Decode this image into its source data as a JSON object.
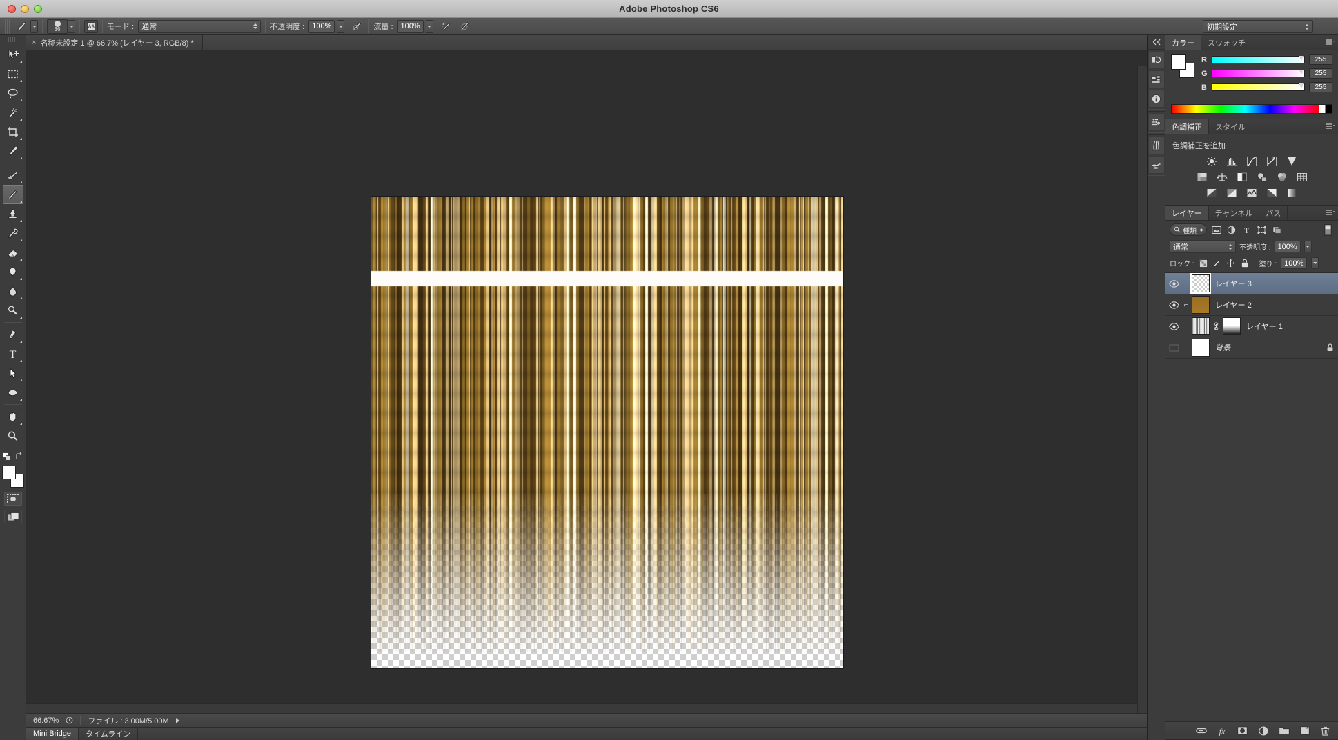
{
  "window": {
    "title": "Adobe Photoshop CS6",
    "traffic_lights": [
      "close",
      "minimize",
      "maximize"
    ]
  },
  "options_bar": {
    "tool_icon": "brush-tool-icon",
    "brush_size": "36",
    "tablet_pressure_icon": "brush-panel-icon",
    "mode_label": "モード :",
    "mode_value": "通常",
    "opacity_label": "不透明度 :",
    "opacity_value": "100%",
    "opacity_pressure_icon": "pressure-opacity-icon",
    "flow_label": "流量 :",
    "flow_value": "100%",
    "airbrush_icon": "airbrush-icon",
    "flow_pressure_icon": "pressure-size-icon",
    "workspace_value": "初期設定"
  },
  "toolbar": {
    "tools": [
      {
        "name": "move-tool",
        "active": false
      },
      {
        "name": "marquee-tool",
        "active": false
      },
      {
        "name": "lasso-tool",
        "active": false
      },
      {
        "name": "magic-wand-tool",
        "active": false
      },
      {
        "name": "crop-tool",
        "active": false
      },
      {
        "name": "eyedropper-tool",
        "active": false
      },
      {
        "name": "healing-brush-tool",
        "active": false
      },
      {
        "name": "brush-tool",
        "active": true
      },
      {
        "name": "clone-stamp-tool",
        "active": false
      },
      {
        "name": "history-brush-tool",
        "active": false
      },
      {
        "name": "eraser-tool",
        "active": false
      },
      {
        "name": "gradient-tool",
        "active": false
      },
      {
        "name": "blur-tool",
        "active": false
      },
      {
        "name": "dodge-tool",
        "active": false
      },
      {
        "name": "pen-tool",
        "active": false
      },
      {
        "name": "type-tool",
        "active": false
      },
      {
        "name": "path-selection-tool",
        "active": false
      },
      {
        "name": "shape-tool",
        "active": false
      },
      {
        "name": "hand-tool",
        "active": false
      },
      {
        "name": "zoom-tool",
        "active": false
      }
    ],
    "foreground_color": "#ffffff",
    "background_color": "#ffffff",
    "quick_mask_icon": "quick-mask-icon",
    "screen_mode_icon": "screen-mode-icon"
  },
  "document": {
    "tab_title": "名称未設定 1 @ 66.7% (レイヤー 3, RGB/8) *",
    "close_glyph": "×"
  },
  "status_bar": {
    "zoom": "66.67%",
    "file_label": "ファイル : 3.00M/5.00M"
  },
  "bottom_bar": {
    "tabs": [
      {
        "label": "Mini Bridge",
        "selected": true
      },
      {
        "label": "タイムライン",
        "selected": false
      }
    ]
  },
  "dock_strip": {
    "buttons": [
      {
        "name": "history-panel-icon"
      },
      {
        "name": "actions-panel-icon"
      },
      {
        "name": "info-panel-icon"
      },
      {
        "name": "properties-panel-icon"
      },
      {
        "name": "brush-panel-icon"
      },
      {
        "name": "brush-presets-panel-icon"
      }
    ]
  },
  "color_panel": {
    "tabs": [
      {
        "label": "カラー",
        "selected": true
      },
      {
        "label": "スウォッチ",
        "selected": false
      }
    ],
    "channels": [
      {
        "ch": "R",
        "value": "255"
      },
      {
        "ch": "G",
        "value": "255"
      },
      {
        "ch": "B",
        "value": "255"
      }
    ],
    "foreground": "#ffffff",
    "background": "#ffffff"
  },
  "adjustments_panel": {
    "tabs": [
      {
        "label": "色調補正",
        "selected": true
      },
      {
        "label": "スタイル",
        "selected": false
      }
    ],
    "heading": "色調補正を追加",
    "icons": [
      "brightness-contrast-icon",
      "levels-icon",
      "curves-icon",
      "exposure-icon",
      "vibrance-icon",
      "hue-saturation-icon",
      "color-balance-icon",
      "black-white-icon",
      "photo-filter-icon",
      "channel-mixer-icon",
      "color-lookup-icon",
      "invert-icon",
      "posterize-icon",
      "threshold-icon",
      "gradient-map-icon",
      "selective-color-icon"
    ]
  },
  "layers_panel": {
    "tabs": [
      {
        "label": "レイヤー",
        "selected": true
      },
      {
        "label": "チャンネル",
        "selected": false
      },
      {
        "label": "パス",
        "selected": false
      }
    ],
    "filter_label": "種類",
    "filter_icons": [
      "filter-pixel-icon",
      "filter-adjustment-icon",
      "filter-type-icon",
      "filter-shape-icon",
      "filter-smartobject-icon"
    ],
    "filter_toggle_icon": "filter-toggle-icon",
    "blend_mode": "通常",
    "opacity_label": "不透明度 :",
    "opacity_value": "100%",
    "lock_label": "ロック :",
    "lock_icons": [
      "lock-transparency-icon",
      "lock-image-icon",
      "lock-position-icon",
      "lock-all-icon"
    ],
    "fill_label": "塗り :",
    "fill_value": "100%",
    "layers": [
      {
        "name": "レイヤー 3",
        "visible": true,
        "selected": true,
        "thumb": "checker",
        "clipped": false,
        "has_mask": false,
        "locked": false,
        "underline": false,
        "italic": false
      },
      {
        "name": "レイヤー 2",
        "visible": true,
        "selected": false,
        "thumb": "brown",
        "clipped": true,
        "has_mask": false,
        "locked": false,
        "underline": false,
        "italic": false
      },
      {
        "name": "レイヤー 1",
        "visible": true,
        "selected": false,
        "thumb": "stripes",
        "clipped": false,
        "has_mask": true,
        "locked": false,
        "underline": true,
        "italic": false
      },
      {
        "name": "背景",
        "visible": false,
        "selected": false,
        "thumb": "white",
        "clipped": false,
        "has_mask": false,
        "locked": true,
        "underline": false,
        "italic": true
      }
    ],
    "bottom_icons": [
      "link-layers-icon",
      "layer-style-icon",
      "layer-mask-icon",
      "adjustment-layer-icon",
      "new-group-icon",
      "new-layer-icon",
      "delete-layer-icon"
    ]
  },
  "canvas": {
    "zoom_percent": "66.67%",
    "artwork_colors": {
      "stripe_dark": "#4a3512",
      "stripe_mid": "#8a6a28",
      "stripe_light": "#c8ab72",
      "stripe_pale": "#e3d4ae",
      "band": "#fdfcf8"
    },
    "description_regions": {
      "upper_stripes_height": 108,
      "white_band_height": 22,
      "lower_stripes_fade_start": 430
    }
  }
}
